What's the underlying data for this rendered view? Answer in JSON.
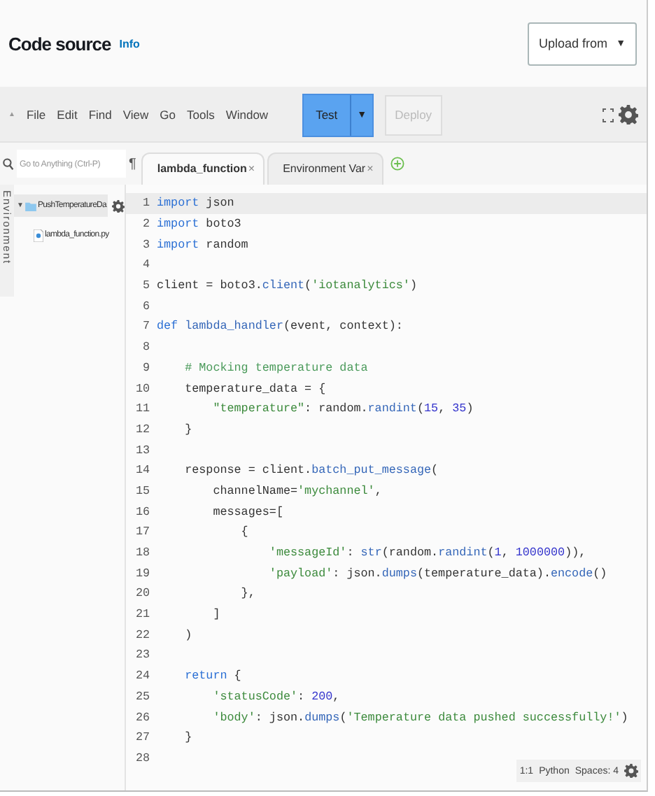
{
  "header": {
    "title": "Code source",
    "info_link": "Info",
    "upload_button": {
      "label": "Upload from",
      "caret": "▼"
    }
  },
  "toolbar": {
    "collapse": "▲",
    "menus": [
      "File",
      "Edit",
      "Find",
      "View",
      "Go",
      "Tools",
      "Window"
    ],
    "test_button": {
      "label": "Test",
      "caret": "▼"
    },
    "deploy_button": {
      "label": "Deploy",
      "disabled": true
    }
  },
  "search": {
    "placeholder": "Go to Anything (Ctrl-P)"
  },
  "pilcrow": "¶",
  "tabs": [
    {
      "label": "lambda_function",
      "close": "×",
      "selected": true
    },
    {
      "label": "Environment Var",
      "close": "×",
      "selected": false
    }
  ],
  "sidebar": {
    "vertical_tab": "Environment",
    "tree": [
      {
        "kind": "folder",
        "toggle": "▼",
        "label": "PushTemperatureDa",
        "expanded": true,
        "children": [
          {
            "kind": "file",
            "label": "lambda_function.py"
          }
        ]
      }
    ]
  },
  "editor": {
    "lines": [
      {
        "number": "1",
        "active": true,
        "tokens": [
          {
            "kind": "kw",
            "text": "import"
          },
          {
            "kind": "plain",
            "text": " json"
          }
        ]
      },
      {
        "number": "2",
        "active": false,
        "tokens": [
          {
            "kind": "kw",
            "text": "import"
          },
          {
            "kind": "plain",
            "text": " boto3"
          }
        ]
      },
      {
        "number": "3",
        "active": false,
        "tokens": [
          {
            "kind": "kw",
            "text": "import"
          },
          {
            "kind": "plain",
            "text": " random"
          }
        ]
      },
      {
        "number": "4",
        "active": false
      },
      {
        "number": "5",
        "active": false,
        "tokens": [
          {
            "kind": "plain",
            "text": "client = boto3."
          },
          {
            "kind": "fn",
            "text": "client"
          },
          {
            "kind": "plain",
            "text": "("
          },
          {
            "kind": "str",
            "text": "'iotanalytics'"
          },
          {
            "kind": "plain",
            "text": ")"
          }
        ]
      },
      {
        "number": "6",
        "active": false
      },
      {
        "number": "7",
        "active": false,
        "tokens": [
          {
            "kind": "kw",
            "text": "def"
          },
          {
            "kind": "fn",
            "text": " lambda_handler"
          },
          {
            "kind": "plain",
            "text": "(event, context):"
          }
        ]
      },
      {
        "number": "8",
        "active": false
      },
      {
        "number": "9",
        "active": false,
        "tokens": [
          {
            "kind": "comment",
            "text": "    # Mocking temperature data"
          }
        ]
      },
      {
        "number": "10",
        "active": false,
        "tokens": [
          {
            "kind": "plain",
            "text": "    temperature_data = {"
          }
        ]
      },
      {
        "number": "11",
        "active": false,
        "tokens": [
          {
            "kind": "str",
            "text": "        \"temperature\""
          },
          {
            "kind": "plain",
            "text": ": random."
          },
          {
            "kind": "fn",
            "text": "randint"
          },
          {
            "kind": "plain",
            "text": "("
          },
          {
            "kind": "num",
            "text": "15"
          },
          {
            "kind": "plain",
            "text": ", "
          },
          {
            "kind": "num",
            "text": "35"
          },
          {
            "kind": "plain",
            "text": ")"
          }
        ]
      },
      {
        "number": "12",
        "active": false,
        "tokens": [
          {
            "kind": "plain",
            "text": "    }"
          }
        ]
      },
      {
        "number": "13",
        "active": false
      },
      {
        "number": "14",
        "active": false,
        "tokens": [
          {
            "kind": "plain",
            "text": "    response = client."
          },
          {
            "kind": "fn",
            "text": "batch_put_message"
          },
          {
            "kind": "plain",
            "text": "("
          }
        ]
      },
      {
        "number": "15",
        "active": false,
        "tokens": [
          {
            "kind": "plain",
            "text": "        channelName="
          },
          {
            "kind": "str",
            "text": "'mychannel'"
          },
          {
            "kind": "plain",
            "text": ","
          }
        ]
      },
      {
        "number": "16",
        "active": false,
        "tokens": [
          {
            "kind": "plain",
            "text": "        messages=["
          }
        ]
      },
      {
        "number": "17",
        "active": false,
        "tokens": [
          {
            "kind": "plain",
            "text": "            {"
          }
        ]
      },
      {
        "number": "18",
        "active": false,
        "tokens": [
          {
            "kind": "str",
            "text": "                'messageId'"
          },
          {
            "kind": "plain",
            "text": ": "
          },
          {
            "kind": "fn",
            "text": "str"
          },
          {
            "kind": "plain",
            "text": "(random."
          },
          {
            "kind": "fn",
            "text": "randint"
          },
          {
            "kind": "plain",
            "text": "("
          },
          {
            "kind": "num",
            "text": "1"
          },
          {
            "kind": "plain",
            "text": ", "
          },
          {
            "kind": "num",
            "text": "1000000"
          },
          {
            "kind": "plain",
            "text": ")),"
          }
        ]
      },
      {
        "number": "19",
        "active": false,
        "tokens": [
          {
            "kind": "str",
            "text": "                'payload'"
          },
          {
            "kind": "plain",
            "text": ": json."
          },
          {
            "kind": "fn",
            "text": "dumps"
          },
          {
            "kind": "plain",
            "text": "(temperature_data)."
          },
          {
            "kind": "fn",
            "text": "encode"
          },
          {
            "kind": "plain",
            "text": "()"
          }
        ]
      },
      {
        "number": "20",
        "active": false,
        "tokens": [
          {
            "kind": "plain",
            "text": "            },"
          }
        ]
      },
      {
        "number": "21",
        "active": false,
        "tokens": [
          {
            "kind": "plain",
            "text": "        ]"
          }
        ]
      },
      {
        "number": "22",
        "active": false,
        "tokens": [
          {
            "kind": "plain",
            "text": "    )"
          }
        ]
      },
      {
        "number": "23",
        "active": false
      },
      {
        "number": "24",
        "active": false,
        "tokens": [
          {
            "kind": "kw",
            "text": "    return"
          },
          {
            "kind": "plain",
            "text": " {"
          }
        ]
      },
      {
        "number": "25",
        "active": false,
        "tokens": [
          {
            "kind": "str",
            "text": "        'statusCode'"
          },
          {
            "kind": "plain",
            "text": ": "
          },
          {
            "kind": "num",
            "text": "200"
          },
          {
            "kind": "plain",
            "text": ","
          }
        ]
      },
      {
        "number": "26",
        "active": false,
        "tokens": [
          {
            "kind": "str",
            "text": "        'body'"
          },
          {
            "kind": "plain",
            "text": ": json."
          },
          {
            "kind": "fn",
            "text": "dumps"
          },
          {
            "kind": "plain",
            "text": "("
          },
          {
            "kind": "str",
            "text": "'Temperature data pushed successfully!'"
          },
          {
            "kind": "plain",
            "text": ")"
          }
        ]
      },
      {
        "number": "27",
        "active": false,
        "tokens": [
          {
            "kind": "plain",
            "text": "    }"
          }
        ]
      },
      {
        "number": "28",
        "active": false
      }
    ]
  },
  "status_bar": {
    "position": "1:1",
    "language": "Python",
    "indent": "Spaces: 4"
  }
}
